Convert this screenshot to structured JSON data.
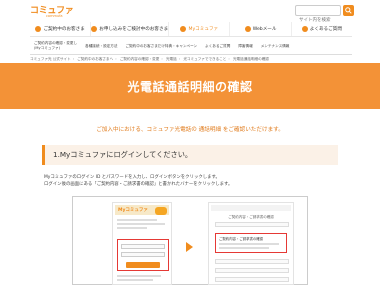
{
  "header": {
    "logo_main": "コミュファ",
    "logo_sub": "commufa",
    "search_placeholder": "サイト内を検索"
  },
  "main_nav": [
    {
      "label": "ご契約中のお客さま"
    },
    {
      "label": "お申し込みをご検討中のお客さま"
    },
    {
      "label": "Myコミュファ",
      "active": true
    },
    {
      "label": "Webメール"
    },
    {
      "label": "よくあるご質問"
    }
  ],
  "sub_nav": [
    {
      "line1": "ご契約内容の確認・変更し",
      "line2": "(Myコミュファ)"
    },
    {
      "line1": "各種接続・設定方法",
      "line2": ""
    },
    {
      "line1": "ご契約中のお客さまだけ特典・キャンペーン",
      "line2": ""
    },
    {
      "line1": "よくあるご質問",
      "line2": ""
    },
    {
      "line1": "障害情報",
      "line2": ""
    },
    {
      "line1": "メンテナンス情報",
      "line2": ""
    }
  ],
  "breadcrumb": [
    "コミュファ光 公式サイト",
    "ご契約中のお客さまへ",
    "ご契約内容の確認・変更",
    "光電話",
    "光コミュファでできること",
    "光電話通話明細の確認"
  ],
  "banner": {
    "title": "光電話通話明細の確認"
  },
  "intro": "ご加入中における、コミュファ光電話の 通話明細 をご確認いただけます。",
  "step1": {
    "title": "1.Myコミュファにログインしてください。",
    "desc_line1": "Myコミュファのログイン ID とパスワードを入力し、ログインボタンをクリックします。",
    "desc_line2": "ログイン後の画面にある「ご契約内容・ご請求書の確認」と書かれたバナーをクリックします。"
  },
  "screenshot": {
    "left_logo": "Myコミュファ",
    "right_title": "ご契約内容・ご請求書の確認",
    "highlight_text": "ご契約内容・ご請求書の確認"
  },
  "colors": {
    "accent": "#f08c1e",
    "banner": "#f39237",
    "highlight": "#e53935"
  }
}
